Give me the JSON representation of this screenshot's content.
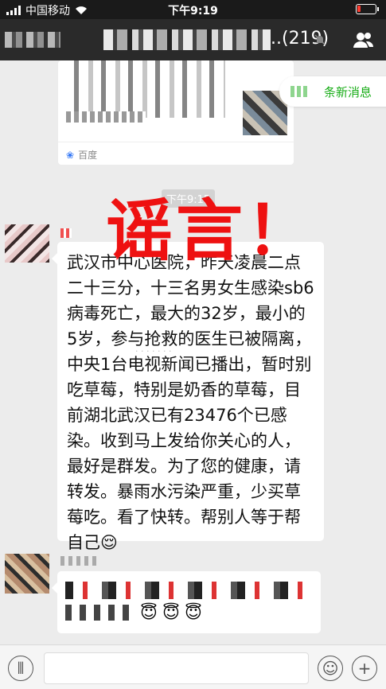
{
  "status_bar": {
    "carrier": "中国移动",
    "time": "下午9:19"
  },
  "nav": {
    "member_count": "..(219)",
    "mute_icon": "mute-bell-icon",
    "people_icon": "group-people-icon"
  },
  "link_card": {
    "source": "百度",
    "source_icon": "baidu-paw-icon"
  },
  "new_messages": {
    "label": "条新消息"
  },
  "timestamp": "下午9:15",
  "rumor_stamp": "谣言！",
  "message": {
    "text": "武汉市中心医院，昨天凌晨二点二十三分，十三名男女生感染sb6病毒死亡，最大的32岁，最小的5岁，参与抢救的医生已被隔离，中央1台电视新闻已播出，暂时别吃草莓，特别是奶香的草莓，目前湖北武汉已有23476个已感染。收到马上发给你关心的人，最好是群发。为了您的健康，请转发。暴雨水污染严重，少买草莓吃。看了快转。帮别人等于帮自己",
    "emoji": "😌"
  },
  "second_message": {
    "emojis": [
      "😇",
      "😇",
      "😇"
    ]
  },
  "input_bar": {
    "voice_icon": "voice-icon",
    "emoji_icon": "emoji-icon",
    "plus_icon": "plus-icon"
  },
  "colors": {
    "stamp": "#ee1111",
    "accent_green": "#1aad19",
    "nav_bg": "#2a2a2a"
  }
}
